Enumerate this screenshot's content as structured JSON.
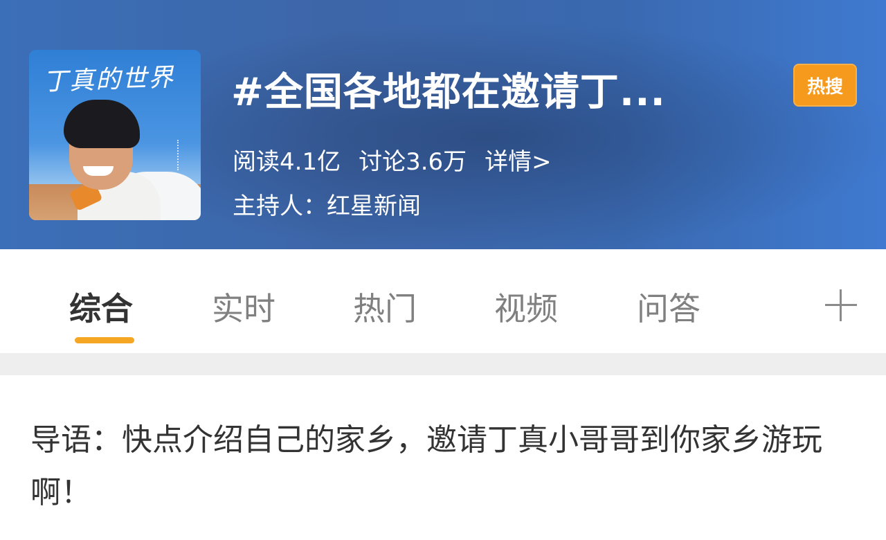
{
  "header": {
    "cover": {
      "title_art": "丁真的世界",
      "icon": "cover-photo-icon"
    },
    "title": "#全国各地都在邀请丁...",
    "badge": "热搜",
    "stats": {
      "read": "阅读4.1亿",
      "discuss": "讨论3.6万",
      "details": "详情>"
    },
    "host": "主持人：红星新闻"
  },
  "tabs": [
    {
      "label": "综合",
      "active": true
    },
    {
      "label": "实时",
      "active": false
    },
    {
      "label": "热门",
      "active": false
    },
    {
      "label": "视频",
      "active": false
    },
    {
      "label": "问答",
      "active": false
    }
  ],
  "add_tab_icon": "plus-icon",
  "guide_text": "导语：快点介绍自己的家乡，邀请丁真小哥哥到你家乡游玩啊！",
  "colors": {
    "header_bg": "#3d66a8",
    "badge_bg": "#f59a1d",
    "tab_underline": "#f5a623",
    "tab_active": "#333333",
    "tab_inactive": "#808080"
  }
}
